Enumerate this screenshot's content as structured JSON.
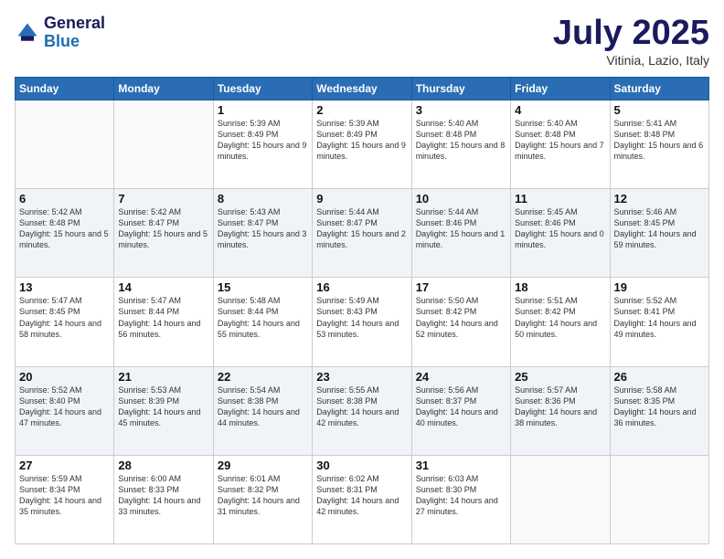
{
  "logo": {
    "line1": "General",
    "line2": "Blue"
  },
  "title": "July 2025",
  "subtitle": "Vitinia, Lazio, Italy",
  "days_header": [
    "Sunday",
    "Monday",
    "Tuesday",
    "Wednesday",
    "Thursday",
    "Friday",
    "Saturday"
  ],
  "weeks": [
    [
      {
        "day": "",
        "info": ""
      },
      {
        "day": "",
        "info": ""
      },
      {
        "day": "1",
        "info": "Sunrise: 5:39 AM\nSunset: 8:49 PM\nDaylight: 15 hours\nand 9 minutes."
      },
      {
        "day": "2",
        "info": "Sunrise: 5:39 AM\nSunset: 8:49 PM\nDaylight: 15 hours\nand 9 minutes."
      },
      {
        "day": "3",
        "info": "Sunrise: 5:40 AM\nSunset: 8:48 PM\nDaylight: 15 hours\nand 8 minutes."
      },
      {
        "day": "4",
        "info": "Sunrise: 5:40 AM\nSunset: 8:48 PM\nDaylight: 15 hours\nand 7 minutes."
      },
      {
        "day": "5",
        "info": "Sunrise: 5:41 AM\nSunset: 8:48 PM\nDaylight: 15 hours\nand 6 minutes."
      }
    ],
    [
      {
        "day": "6",
        "info": "Sunrise: 5:42 AM\nSunset: 8:48 PM\nDaylight: 15 hours\nand 5 minutes."
      },
      {
        "day": "7",
        "info": "Sunrise: 5:42 AM\nSunset: 8:47 PM\nDaylight: 15 hours\nand 5 minutes."
      },
      {
        "day": "8",
        "info": "Sunrise: 5:43 AM\nSunset: 8:47 PM\nDaylight: 15 hours\nand 3 minutes."
      },
      {
        "day": "9",
        "info": "Sunrise: 5:44 AM\nSunset: 8:47 PM\nDaylight: 15 hours\nand 2 minutes."
      },
      {
        "day": "10",
        "info": "Sunrise: 5:44 AM\nSunset: 8:46 PM\nDaylight: 15 hours\nand 1 minute."
      },
      {
        "day": "11",
        "info": "Sunrise: 5:45 AM\nSunset: 8:46 PM\nDaylight: 15 hours\nand 0 minutes."
      },
      {
        "day": "12",
        "info": "Sunrise: 5:46 AM\nSunset: 8:45 PM\nDaylight: 14 hours\nand 59 minutes."
      }
    ],
    [
      {
        "day": "13",
        "info": "Sunrise: 5:47 AM\nSunset: 8:45 PM\nDaylight: 14 hours\nand 58 minutes."
      },
      {
        "day": "14",
        "info": "Sunrise: 5:47 AM\nSunset: 8:44 PM\nDaylight: 14 hours\nand 56 minutes."
      },
      {
        "day": "15",
        "info": "Sunrise: 5:48 AM\nSunset: 8:44 PM\nDaylight: 14 hours\nand 55 minutes."
      },
      {
        "day": "16",
        "info": "Sunrise: 5:49 AM\nSunset: 8:43 PM\nDaylight: 14 hours\nand 53 minutes."
      },
      {
        "day": "17",
        "info": "Sunrise: 5:50 AM\nSunset: 8:42 PM\nDaylight: 14 hours\nand 52 minutes."
      },
      {
        "day": "18",
        "info": "Sunrise: 5:51 AM\nSunset: 8:42 PM\nDaylight: 14 hours\nand 50 minutes."
      },
      {
        "day": "19",
        "info": "Sunrise: 5:52 AM\nSunset: 8:41 PM\nDaylight: 14 hours\nand 49 minutes."
      }
    ],
    [
      {
        "day": "20",
        "info": "Sunrise: 5:52 AM\nSunset: 8:40 PM\nDaylight: 14 hours\nand 47 minutes."
      },
      {
        "day": "21",
        "info": "Sunrise: 5:53 AM\nSunset: 8:39 PM\nDaylight: 14 hours\nand 45 minutes."
      },
      {
        "day": "22",
        "info": "Sunrise: 5:54 AM\nSunset: 8:38 PM\nDaylight: 14 hours\nand 44 minutes."
      },
      {
        "day": "23",
        "info": "Sunrise: 5:55 AM\nSunset: 8:38 PM\nDaylight: 14 hours\nand 42 minutes."
      },
      {
        "day": "24",
        "info": "Sunrise: 5:56 AM\nSunset: 8:37 PM\nDaylight: 14 hours\nand 40 minutes."
      },
      {
        "day": "25",
        "info": "Sunrise: 5:57 AM\nSunset: 8:36 PM\nDaylight: 14 hours\nand 38 minutes."
      },
      {
        "day": "26",
        "info": "Sunrise: 5:58 AM\nSunset: 8:35 PM\nDaylight: 14 hours\nand 36 minutes."
      }
    ],
    [
      {
        "day": "27",
        "info": "Sunrise: 5:59 AM\nSunset: 8:34 PM\nDaylight: 14 hours\nand 35 minutes."
      },
      {
        "day": "28",
        "info": "Sunrise: 6:00 AM\nSunset: 8:33 PM\nDaylight: 14 hours\nand 33 minutes."
      },
      {
        "day": "29",
        "info": "Sunrise: 6:01 AM\nSunset: 8:32 PM\nDaylight: 14 hours\nand 31 minutes."
      },
      {
        "day": "30",
        "info": "Sunrise: 6:02 AM\nSunset: 8:31 PM\nDaylight: 14 hours\nand 42 minutes."
      },
      {
        "day": "31",
        "info": "Sunrise: 6:03 AM\nSunset: 8:30 PM\nDaylight: 14 hours\nand 27 minutes."
      },
      {
        "day": "",
        "info": ""
      },
      {
        "day": "",
        "info": ""
      }
    ]
  ]
}
